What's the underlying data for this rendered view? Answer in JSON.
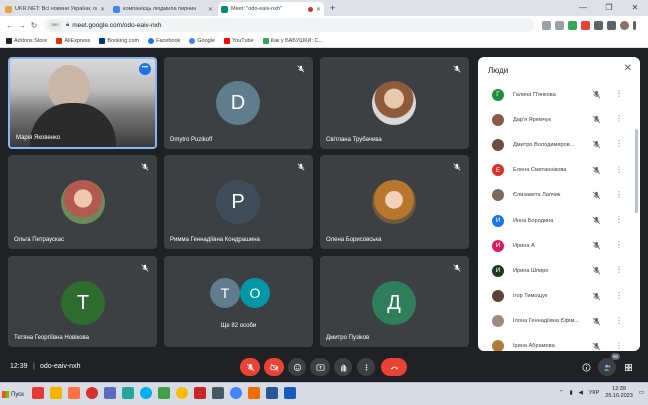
{
  "browser": {
    "tabs": [
      {
        "label": "UKR.NET: Всі новини України, ос",
        "color": "#e8a33d",
        "active": false
      },
      {
        "label": "компанієць людмила пирнин",
        "color": "#4285f4",
        "active": false
      },
      {
        "label": "Meet: \"odo-eaiv-nxh\"",
        "color": "#00897b",
        "active": true
      }
    ],
    "new_tab": "+",
    "url": "meet.google.com/odo-eaiv-nxh",
    "profile_chip": "Ven",
    "bookmarks": [
      {
        "label": "Addons Store",
        "color": "#202124"
      },
      {
        "label": "AliExpress",
        "color": "#e62e04"
      },
      {
        "label": "Booking.com",
        "color": "#003580"
      },
      {
        "label": "Facebook",
        "color": "#1877f2"
      },
      {
        "label": "Google",
        "color": "#4285f4"
      },
      {
        "label": "YouTube",
        "color": "#ff0000"
      },
      {
        "label": "Как у БАБУШКИ: С...",
        "color": "#34a853"
      }
    ]
  },
  "tiles": [
    {
      "name": "Марія Яковенко",
      "kind": "video",
      "highlight": true
    },
    {
      "name": "Dmytro Puzikoff",
      "kind": "letter",
      "letter": "D",
      "color": "#5f7d8c"
    },
    {
      "name": "Світлана Трубачева",
      "kind": "photo",
      "color": "#a47a5c"
    },
    {
      "name": "Ольга Петраускас",
      "kind": "photo",
      "color": "#8a5a44"
    },
    {
      "name": "Римма Геннадіївна Кондрашина",
      "kind": "letter",
      "letter": "P",
      "color": "#3f4d5a"
    },
    {
      "name": "Олена Борисовська",
      "kind": "photo",
      "color": "#b07a3a"
    },
    {
      "name": "Тетяна Георгіївна Новікова",
      "kind": "letter",
      "letter": "T",
      "color": "#2e6b2e"
    },
    {
      "name": "Ще 82 особи",
      "kind": "group",
      "letters": [
        "T",
        "O"
      ],
      "colors": [
        "#5f7d8c",
        "#0097a7"
      ]
    },
    {
      "name": "Дмитро Пузіков",
      "kind": "letter",
      "letter": "Д",
      "color": "#2e7d5b"
    }
  ],
  "people_panel": {
    "title": "Люди",
    "participants": [
      {
        "name": "Галина П'янкова",
        "letter": "Г",
        "color": "#1e8e3e"
      },
      {
        "name": "Дар'я Яремчук",
        "letter": "",
        "color": "#8a5a44"
      },
      {
        "name": "Дмитро Володимиров...",
        "letter": "",
        "color": "#6d4c41"
      },
      {
        "name": "Елена Сметаннікова",
        "letter": "Е",
        "color": "#d93025"
      },
      {
        "name": "Єлизавета Лапчик",
        "letter": "",
        "color": "#7b6a5a"
      },
      {
        "name": "Инна Бородина",
        "letter": "И",
        "color": "#1a73e8"
      },
      {
        "name": "Ирина А",
        "letter": "И",
        "color": "#d81b60"
      },
      {
        "name": "Ирина Шпиро",
        "letter": "И",
        "color": "#1e3a1e"
      },
      {
        "name": "Ігор Тимощук",
        "letter": "",
        "color": "#5d4037"
      },
      {
        "name": "Ілона Геннадіївна Єфім...",
        "letter": "",
        "color": "#a1887f"
      },
      {
        "name": "Ірина Абрамова",
        "letter": "",
        "color": "#b07a3a"
      }
    ]
  },
  "controls": {
    "time": "12:39",
    "separator": "|",
    "meeting_code": "odo-eaiv-nxh",
    "people_count": "90"
  },
  "taskbar": {
    "start_label": "Пуск",
    "language": "УКР",
    "time": "12:39",
    "date": "25.10.2023"
  }
}
